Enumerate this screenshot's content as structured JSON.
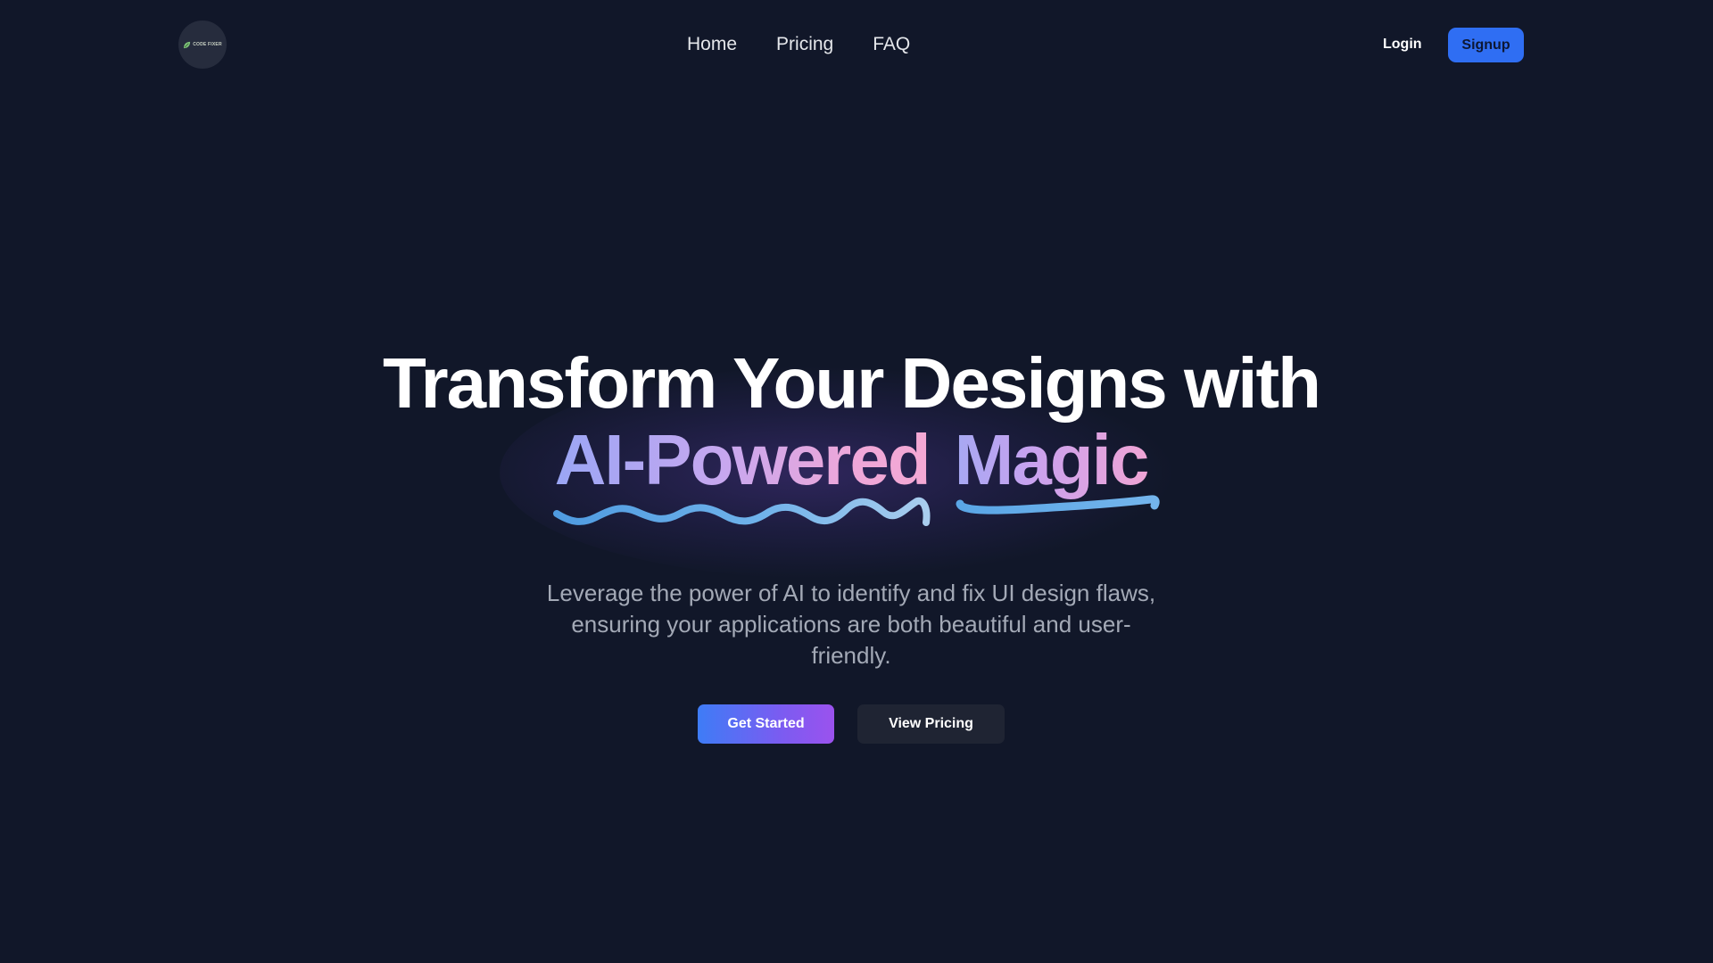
{
  "nav": {
    "logo_text": "CODE FIXER",
    "links": [
      {
        "label": "Home"
      },
      {
        "label": "Pricing"
      },
      {
        "label": "FAQ"
      }
    ],
    "login_label": "Login",
    "signup_label": "Signup"
  },
  "hero": {
    "title_line1": "Transform Your Designs with",
    "title_word1": "AI-Powered",
    "title_word2": "Magic",
    "subtitle": "Leverage the power of AI to identify and fix UI design flaws, ensuring your applications are both beautiful and user-friendly.",
    "primary_cta": "Get Started",
    "secondary_cta": "View Pricing"
  },
  "colors": {
    "background": "#111729",
    "accent_blue": "#2f6ef3",
    "gradient_purple": "#9b52ee",
    "squiggle_blue": "#5ba8e6",
    "subtitle_gray": "#a3a9b6"
  },
  "icons": {
    "logo": "leaf-logo-icon",
    "squiggle": "wavy-underline-icon",
    "underline": "brush-underline-icon"
  }
}
